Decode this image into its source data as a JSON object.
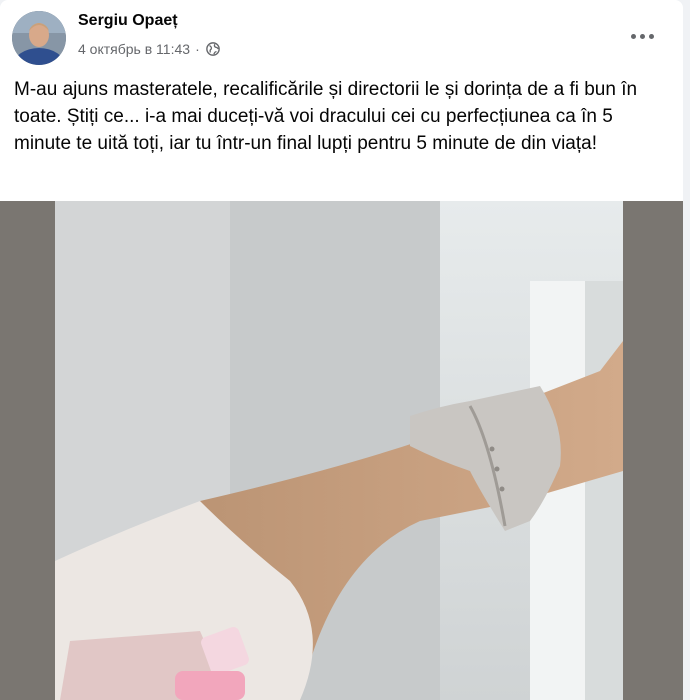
{
  "post": {
    "author": "Sergiu Opaeț",
    "timestamp": "4 октябрь в 11:43",
    "separator": "·",
    "privacy_icon": "globe-icon",
    "more_icon": "more-options-icon",
    "text": "M-au ajuns masteratele, recalificările și directorii le și dorința de a fi bun în toate. Știți ce... i-a mai duceți-vă voi dracului cei cu perfecțiunea ca în 5 minute te uită toți, iar tu într-un final lupți pentru 5 minute de din viața!"
  },
  "colors": {
    "background": "#f0f2f5",
    "card": "#ffffff",
    "primary_text": "#050505",
    "secondary_text": "#65676b"
  }
}
